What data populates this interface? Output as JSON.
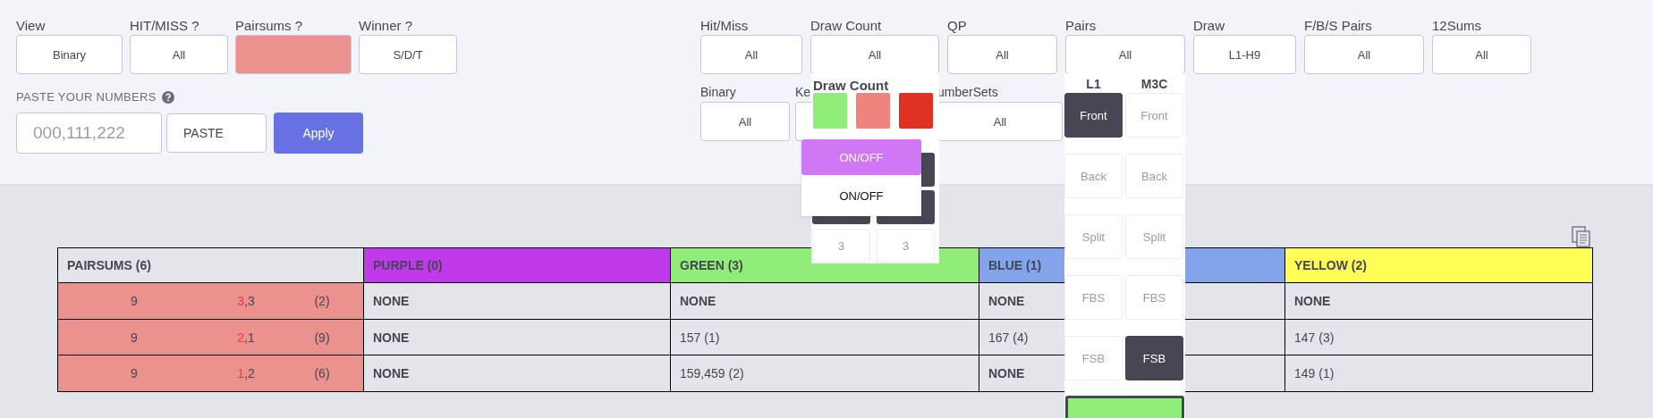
{
  "left_filters": [
    {
      "label": "View",
      "value": "Binary",
      "kind": "select"
    },
    {
      "label": "HIT/MISS ?",
      "value": "All",
      "kind": "select"
    },
    {
      "label": "Pairsums ?",
      "kind": "swatch",
      "color": "#eb918e"
    },
    {
      "label": "Winner ?",
      "value": "S/D/T",
      "kind": "select"
    }
  ],
  "paste": {
    "label": "PASTE YOUR NUMBERS",
    "placeholder": "000,111,222",
    "paste_button": "PASTE",
    "apply_button": "Apply"
  },
  "right_filters_row1": [
    {
      "label": "Hit/Miss",
      "value": "All"
    },
    {
      "label": "Draw Count",
      "value": "All"
    },
    {
      "label": "QP",
      "value": "All"
    },
    {
      "label": "Pairs",
      "value": "All"
    },
    {
      "label": "Draw",
      "value": "L1-H9"
    },
    {
      "label": "F/B/S Pairs",
      "value": "All"
    },
    {
      "label": "12Sums",
      "value": "All"
    }
  ],
  "right_filters_row2": [
    {
      "label": "Binary",
      "value": "All"
    },
    {
      "label": "Ke"
    },
    {
      "label": "umberSets",
      "value": "All"
    }
  ],
  "draw_count_panel": {
    "title": "Draw Count",
    "swatches": [
      {
        "color": "#90ee78"
      },
      {
        "color": "#ef837d"
      },
      {
        "color": "#de3223"
      }
    ],
    "buttons": [
      "3",
      "3"
    ]
  },
  "toggle_menu": [
    {
      "label": "ON/OFF",
      "selected": true
    },
    {
      "label": "ON/OFF",
      "selected": false
    }
  ],
  "pairs_panel": {
    "columns": [
      "L1",
      "M3C"
    ],
    "rows": [
      [
        {
          "label": "Front",
          "selected": true
        },
        {
          "label": "Front",
          "selected": false
        }
      ],
      [
        {
          "label": "Back",
          "selected": false
        },
        {
          "label": "Back",
          "selected": false
        }
      ],
      [
        {
          "label": "Split",
          "selected": false
        },
        {
          "label": "Split",
          "selected": false
        }
      ],
      [
        {
          "label": "FBS",
          "selected": false
        },
        {
          "label": "FBS",
          "selected": false
        }
      ],
      [
        {
          "label": "FSB",
          "selected": false
        },
        {
          "label": "FSB",
          "selected": true
        }
      ]
    ]
  },
  "table": {
    "pairsums_header": "PAIRSUMS (6)",
    "pairsums_rows": [
      {
        "sum": "9",
        "hit": "3",
        "rest": ",3",
        "count": "(2)"
      },
      {
        "sum": "9",
        "hit": "2",
        "rest": ",1",
        "count": "(9)"
      },
      {
        "sum": "9",
        "hit": "1",
        "rest": ",2",
        "count": "(6)"
      }
    ],
    "columns": [
      {
        "header": "PURPLE (0)",
        "color": "#c03aec",
        "cells": [
          {
            "text": "NONE",
            "bold": true
          },
          {
            "text": "NONE",
            "bold": true
          },
          {
            "text": "NONE",
            "bold": true
          }
        ]
      },
      {
        "header": "GREEN (3)",
        "color": "#90ee78",
        "cells": [
          {
            "text": "NONE",
            "bold": true
          },
          {
            "text": "157 (1)",
            "bold": false
          },
          {
            "text": "159,459 (2)",
            "bold": false
          }
        ]
      },
      {
        "header": "BLUE (1)",
        "color": "#82a4eb",
        "cells": [
          {
            "text": "NONE",
            "bold": true
          },
          {
            "text": "167 (4)",
            "bold": false
          },
          {
            "text": "NONE",
            "bold": true
          }
        ]
      },
      {
        "header": "YELLOW (2)",
        "color": "#ffff55",
        "cells": [
          {
            "text": "NONE",
            "bold": true
          },
          {
            "text": "147 (3)",
            "bold": false
          },
          {
            "text": "149 (1)",
            "bold": false
          }
        ]
      }
    ]
  }
}
